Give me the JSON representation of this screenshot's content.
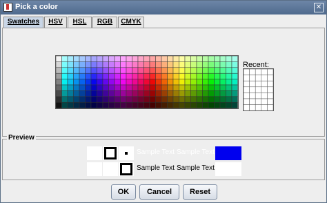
{
  "window": {
    "title": "Pick a color",
    "close_glyph": "✕"
  },
  "tabs": [
    {
      "label": "Swatches",
      "mnemonic": "S"
    },
    {
      "label": "HSV",
      "mnemonic": "H"
    },
    {
      "label": "HSL",
      "mnemonic": "L"
    },
    {
      "label": "RGB",
      "mnemonic": "G"
    },
    {
      "label": "CMYK",
      "mnemonic": "M"
    }
  ],
  "swatches": {
    "recent_label": "Recent:"
  },
  "preview": {
    "label": "Preview",
    "sample_text": "Sample Text",
    "selected_color": "#0000ee"
  },
  "buttons": {
    "ok": "OK",
    "cancel": "Cancel",
    "reset": "Reset"
  }
}
